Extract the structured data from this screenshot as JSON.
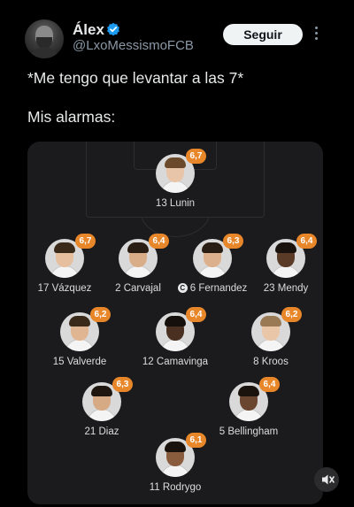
{
  "post": {
    "author_name": "Álex",
    "handle": "@LxoMessismoFCB",
    "follow_label": "Seguir",
    "line1": "*Me tengo que levantar a las 7*",
    "line2": "Mis alarmas:"
  },
  "lineup": {
    "players": [
      {
        "number": "13",
        "name": "Lunin",
        "rating": "6,7",
        "skin": "#e8c4a8",
        "hair": "#6a4a2a"
      },
      {
        "number": "17",
        "name": "Vázquez",
        "rating": "6,7",
        "skin": "#e5bf9e",
        "hair": "#3b2a1a"
      },
      {
        "number": "2",
        "name": "Carvajal",
        "rating": "6,4",
        "skin": "#d9ad88",
        "hair": "#2a1e14"
      },
      {
        "number": "6",
        "name": "Fernandez",
        "rating": "6,3",
        "captain": "C",
        "skin": "#dcb08c",
        "hair": "#2a1e14"
      },
      {
        "number": "23",
        "name": "Mendy",
        "rating": "6,4",
        "skin": "#5a3b28",
        "hair": "#1a120c"
      },
      {
        "number": "15",
        "name": "Valverde",
        "rating": "6,2",
        "skin": "#dfb592",
        "hair": "#3a2a1a"
      },
      {
        "number": "12",
        "name": "Camavinga",
        "rating": "6,4",
        "skin": "#4a3020",
        "hair": "#15100b"
      },
      {
        "number": "8",
        "name": "Kroos",
        "rating": "6,2",
        "skin": "#e9c6a8",
        "hair": "#9a7a55"
      },
      {
        "number": "21",
        "name": "Diaz",
        "rating": "6,3",
        "skin": "#d7aa86",
        "hair": "#1f1610"
      },
      {
        "number": "5",
        "name": "Bellingham",
        "rating": "6,4",
        "skin": "#6a4530",
        "hair": "#1a120c"
      },
      {
        "number": "11",
        "name": "Rodrygo",
        "rating": "6,1",
        "skin": "#8a5c3e",
        "hair": "#1a120c"
      }
    ]
  },
  "colors": {
    "rating_badge": "#e8862a",
    "verified": "#1d9bf0",
    "pitch_bg": "#1b1b1d"
  },
  "icons": {
    "verified": "verified-badge-icon",
    "more": "more-dots-icon",
    "mute": "volume-muted-icon"
  }
}
